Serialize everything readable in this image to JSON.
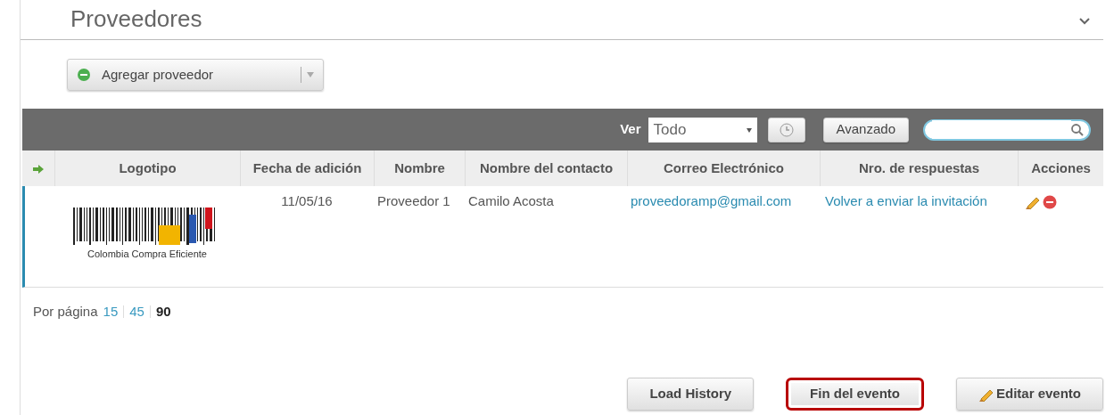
{
  "section": {
    "title": "Proveedores",
    "collapsed": false
  },
  "add_button": {
    "label": "Agregar proveedor"
  },
  "toolbar": {
    "view_label": "Ver",
    "view_select": {
      "value": "Todo"
    },
    "advanced_button": "Avanzado"
  },
  "table": {
    "columns": [
      "Logotipo",
      "Fecha de adición",
      "Nombre",
      "Nombre del contacto",
      "Correo Electrónico",
      "Nro. de respuestas",
      "Acciones"
    ],
    "rows": [
      {
        "selected": true,
        "logo": {
          "caption": "Colombia Compra Eficiente"
        },
        "date": "11/05/16",
        "name": "Proveedor 1",
        "contact": "Camilo Acosta",
        "email": "proveedoramp@gmail.com",
        "responses": "Volver a enviar la invitación"
      }
    ]
  },
  "pagination": {
    "label": "Por página",
    "options": [
      {
        "label": "15",
        "selected": false
      },
      {
        "label": "45",
        "selected": false
      },
      {
        "label": "90",
        "selected": true
      }
    ]
  },
  "footer_buttons": [
    {
      "label": "Load History",
      "kind": "plain",
      "highlighted": false
    },
    {
      "label": "Fin del evento",
      "kind": "plain",
      "highlighted": true
    },
    {
      "label": "Editar evento",
      "kind": "edit",
      "highlighted": false
    }
  ]
}
